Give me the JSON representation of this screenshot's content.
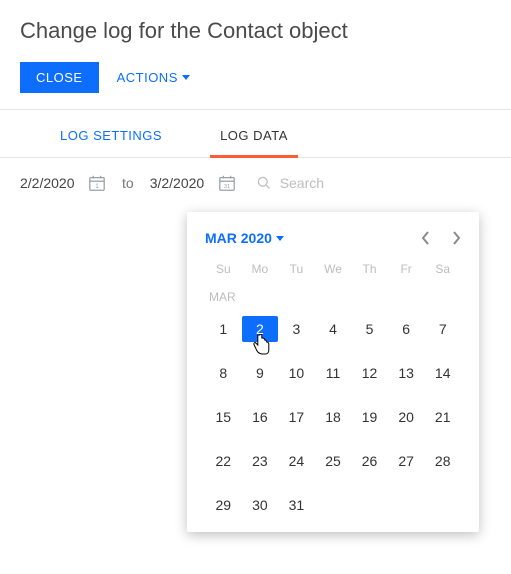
{
  "title": "Change log for the Contact object",
  "toolbar": {
    "close_label": "CLOSE",
    "actions_label": "ACTIONS"
  },
  "tabs": {
    "settings": "LOG SETTINGS",
    "data": "LOG DATA",
    "active": "data"
  },
  "dates": {
    "from": "2/2/2020",
    "to": "3/2/2020",
    "from_icon_day": "1",
    "to_icon_day": "31",
    "to_label": "to"
  },
  "search": {
    "placeholder": "Search"
  },
  "datepicker": {
    "month_label": "MAR 2020",
    "dow": [
      "Su",
      "Mo",
      "Tu",
      "We",
      "Th",
      "Fr",
      "Sa"
    ],
    "section_label": "MAR",
    "first_day_offset": 0,
    "days_in_month": 31,
    "selected_day": 2
  }
}
